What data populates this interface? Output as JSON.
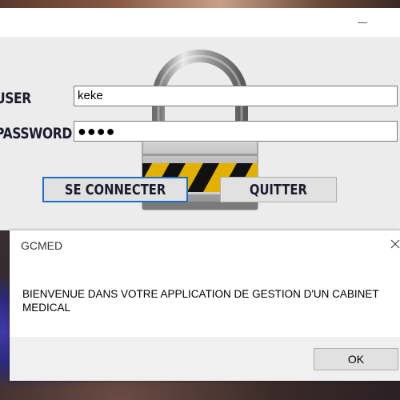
{
  "login": {
    "user_label": "USER",
    "password_label": "PASSWORD",
    "user_value": "keke",
    "password_value": "●●●●",
    "connect_button": "SE CONNECTER",
    "quit_button": "QUITTER"
  },
  "dialog": {
    "title": "GCMED",
    "message": "BIENVENUE DANS VOTRE APPLICATION DE GESTION D'UN CABINET MEDICAL",
    "ok_button": "OK"
  },
  "icons": {
    "padlock": "padlock-icon",
    "close": "close-icon",
    "minimize": "minimize-icon"
  },
  "colors": {
    "focus_border": "#1d6fc8",
    "window_bg": "#ececec",
    "button_bg": "#e1e1e1"
  }
}
